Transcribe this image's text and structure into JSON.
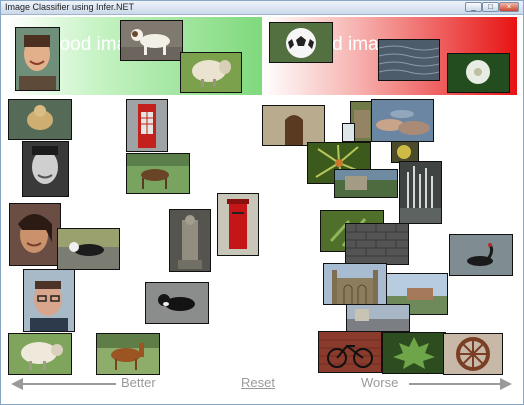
{
  "window": {
    "title": "Image Classifier using Infer.NET",
    "controls": [
      "minimize-icon",
      "maximize-icon",
      "close-icon"
    ]
  },
  "headers": {
    "good": {
      "label": "good images"
    },
    "bad": {
      "label": "bad images"
    }
  },
  "footer": {
    "better_label": "Better",
    "reset_label": "Reset",
    "worse_label": "Worse"
  },
  "colors": {
    "good_header": "#7fd97c",
    "bad_header": "#e71313",
    "arrow": "#9a9a9a"
  },
  "images": [
    {
      "id": "smiling-man-portrait",
      "group": "good-header"
    },
    {
      "id": "jack-russell-dog",
      "group": "good-header"
    },
    {
      "id": "sheep-in-field",
      "group": "good-header"
    },
    {
      "id": "soccer-ball",
      "group": "bad-header"
    },
    {
      "id": "water-surface",
      "group": "bad-header"
    },
    {
      "id": "dandelion-seedhead",
      "group": "bad-header"
    },
    {
      "id": "yellow-dog"
    },
    {
      "id": "red-telephone-box"
    },
    {
      "id": "man-face-bw"
    },
    {
      "id": "brown-horse"
    },
    {
      "id": "woman-portrait"
    },
    {
      "id": "cat-on-path"
    },
    {
      "id": "stone-statue"
    },
    {
      "id": "red-postbox"
    },
    {
      "id": "man-with-glasses"
    },
    {
      "id": "black-white-cat"
    },
    {
      "id": "white-sheep"
    },
    {
      "id": "chestnut-horse"
    },
    {
      "id": "wooden-door"
    },
    {
      "id": "building-facade"
    },
    {
      "id": "clouds-sky"
    },
    {
      "id": "lemons"
    },
    {
      "id": "pine-needles"
    },
    {
      "id": "night-fountain"
    },
    {
      "id": "green-leaves"
    },
    {
      "id": "stone-wall"
    },
    {
      "id": "black-swan"
    },
    {
      "id": "gothic-chapel"
    },
    {
      "id": "river-bridge"
    },
    {
      "id": "street-scene"
    },
    {
      "id": "bicycle"
    },
    {
      "id": "maple-leaf"
    },
    {
      "id": "cart-wheel"
    }
  ]
}
